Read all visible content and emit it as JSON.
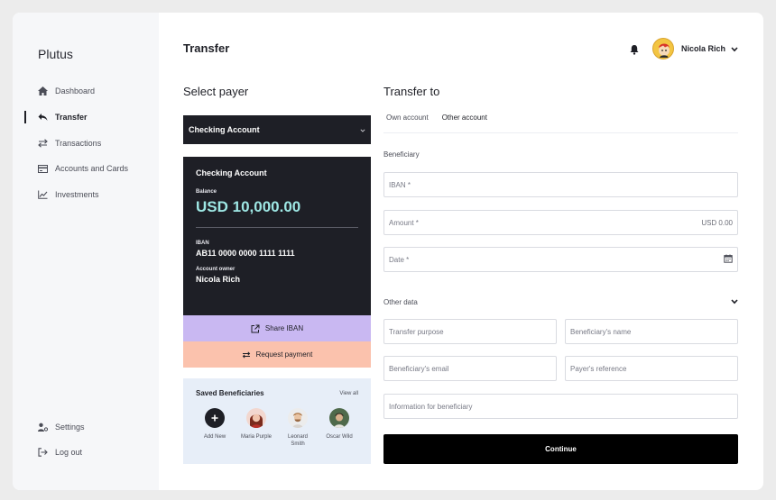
{
  "brand": "Plutus",
  "nav": [
    {
      "label": "Dashboard",
      "icon": "home-icon"
    },
    {
      "label": "Transfer",
      "icon": "reply-arrow-icon",
      "active": true
    },
    {
      "label": "Transactions",
      "icon": "swap-arrows-icon"
    },
    {
      "label": "Accounts and Cards",
      "icon": "credit-card-icon"
    },
    {
      "label": "Investments",
      "icon": "line-chart-icon"
    }
  ],
  "nav_bottom": [
    {
      "label": "Settings",
      "icon": "user-settings-icon"
    },
    {
      "label": "Log out",
      "icon": "logout-icon"
    }
  ],
  "header": {
    "title": "Transfer",
    "user_name": "Nicola Rich"
  },
  "payer": {
    "heading": "Select payer",
    "selected_account": "Checking Account",
    "card": {
      "account_name": "Checking Account",
      "balance_label": "Balance",
      "balance": "USD 10,000.00",
      "iban_label": "IBAN",
      "iban": "AB11 0000 0000 1111 1111",
      "owner_label": "Account owner",
      "owner": "Nicola Rich"
    },
    "share_label": "Share IBAN",
    "request_label": "Request payment"
  },
  "saved": {
    "title": "Saved Beneficiaries",
    "view_all": "View all",
    "items": [
      {
        "name": "Add New"
      },
      {
        "name": "Maria Purple"
      },
      {
        "name": "Leonard Smith"
      },
      {
        "name": "Oscar Wild"
      }
    ]
  },
  "transfer": {
    "heading": "Transfer to",
    "tabs": [
      "Own account",
      "Other account"
    ],
    "beneficiary_label": "Beneficiary",
    "iban_placeholder": "IBAN *",
    "amount_placeholder": "Amount *",
    "amount_suffix": "USD 0.00",
    "date_placeholder": "Date *",
    "other_data_label": "Other data",
    "purpose_placeholder": "Transfer purpose",
    "beneficiary_name_placeholder": "Beneficiary's name",
    "beneficiary_email_placeholder": "Beneficiary's email",
    "payer_reference_placeholder": "Payer's reference",
    "info_placeholder": "Information for beneficiary",
    "continue_label": "Continue"
  },
  "colors": {
    "dark": "#1e1f26",
    "balance": "#9ee7e4",
    "share": "#c9b8f2",
    "request": "#fbc2ad",
    "saved_bg": "#e7eef8"
  }
}
